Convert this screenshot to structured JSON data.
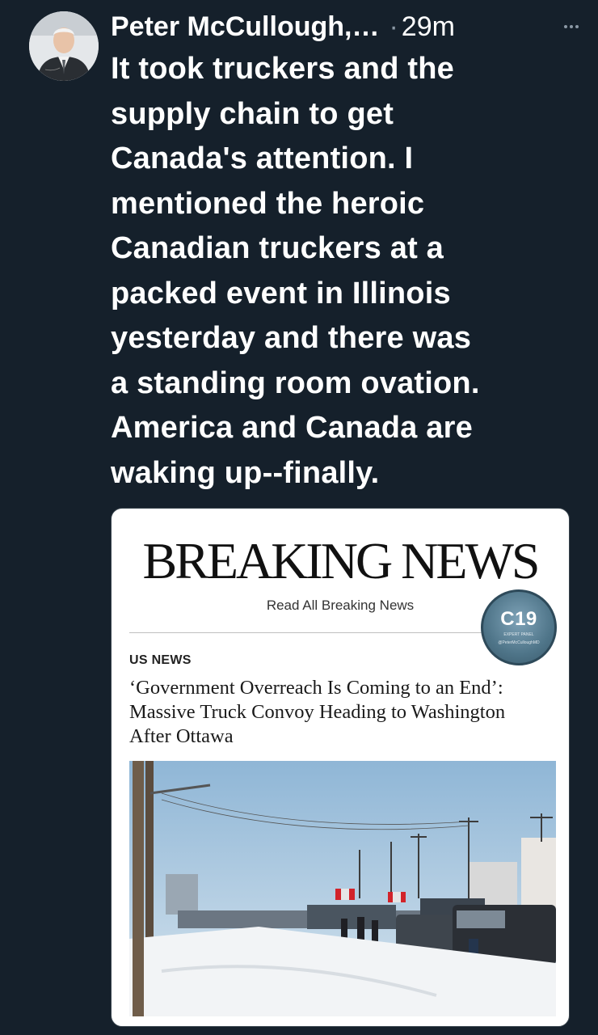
{
  "tweet": {
    "author_name": "Peter McCullough,…",
    "separator": "·",
    "time": "29m",
    "text": "It took truckers and the\nsupply chain to get\nCanada's attention.  I\nmentioned the heroic\nCanadian truckers at a\npacked event in Illinois\nyesterday and there was\na standing room ovation.\nAmerica and Canada are\nwaking up--finally."
  },
  "card": {
    "masthead": "BREAKING NEWS",
    "read_all_link": "Read All Breaking News",
    "badge": {
      "title": "C19",
      "subtitle": "EXPERT PANEL",
      "handle": "@PeterMcCulloughMD"
    },
    "section": "US NEWS",
    "headline": "‘Government Overreach Is Coming to an End’: Massive Truck Convoy Heading to Washington After Ottawa"
  },
  "colors": {
    "background": "#15202b",
    "card_background": "#ffffff",
    "muted_text": "#8b98a5"
  },
  "icons": {
    "more": "more-horizontal-icon"
  }
}
